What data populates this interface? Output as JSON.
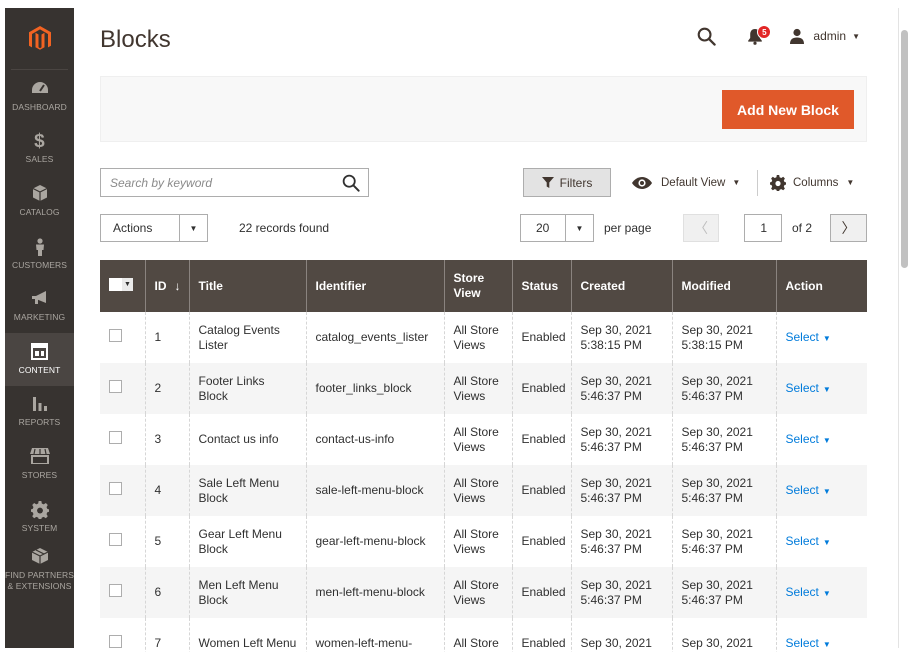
{
  "sidebar": {
    "items": [
      {
        "label": "DASHBOARD",
        "icon": "dashboard-gauge-icon"
      },
      {
        "label": "SALES",
        "icon": "dollar-icon"
      },
      {
        "label": "CATALOG",
        "icon": "cube-icon"
      },
      {
        "label": "CUSTOMERS",
        "icon": "person-icon"
      },
      {
        "label": "MARKETING",
        "icon": "megaphone-icon"
      },
      {
        "label": "CONTENT",
        "icon": "layout-icon",
        "active": true
      },
      {
        "label": "REPORTS",
        "icon": "bar-chart-icon"
      },
      {
        "label": "STORES",
        "icon": "storefront-icon"
      },
      {
        "label": "SYSTEM",
        "icon": "gear-icon"
      },
      {
        "label": "FIND PARTNERS & EXTENSIONS",
        "icon": "boxes-icon"
      }
    ]
  },
  "header": {
    "title": "Blocks",
    "notifications_count": "5",
    "user_name": "admin"
  },
  "toolbar": {
    "add_new_label": "Add New Block"
  },
  "grid_controls": {
    "search_placeholder": "Search by keyword",
    "filters_label": "Filters",
    "view_label": "Default View",
    "columns_label": "Columns",
    "actions_label": "Actions",
    "records_found": "22 records found",
    "per_page_value": "20",
    "per_page_label": "per page",
    "current_page": "1",
    "total_pages_label": "of 2"
  },
  "table": {
    "columns": [
      "ID",
      "Title",
      "Identifier",
      "Store View",
      "Status",
      "Created",
      "Modified",
      "Action"
    ],
    "sort_indicator": "↓",
    "rows": [
      {
        "id": "1",
        "title": "Catalog Events Lister",
        "identifier": "catalog_events_lister",
        "store_view": "All Store Views",
        "status": "Enabled",
        "created": "Sep 30, 2021 5:38:15 PM",
        "modified": "Sep 30, 2021 5:38:15 PM",
        "action": "Select"
      },
      {
        "id": "2",
        "title": "Footer Links Block",
        "identifier": "footer_links_block",
        "store_view": "All Store Views",
        "status": "Enabled",
        "created": "Sep 30, 2021 5:46:37 PM",
        "modified": "Sep 30, 2021 5:46:37 PM",
        "action": "Select"
      },
      {
        "id": "3",
        "title": "Contact us info",
        "identifier": "contact-us-info",
        "store_view": "All Store Views",
        "status": "Enabled",
        "created": "Sep 30, 2021 5:46:37 PM",
        "modified": "Sep 30, 2021 5:46:37 PM",
        "action": "Select"
      },
      {
        "id": "4",
        "title": "Sale Left Menu Block",
        "identifier": "sale-left-menu-block",
        "store_view": "All Store Views",
        "status": "Enabled",
        "created": "Sep 30, 2021 5:46:37 PM",
        "modified": "Sep 30, 2021 5:46:37 PM",
        "action": "Select"
      },
      {
        "id": "5",
        "title": "Gear Left Menu Block",
        "identifier": "gear-left-menu-block",
        "store_view": "All Store Views",
        "status": "Enabled",
        "created": "Sep 30, 2021 5:46:37 PM",
        "modified": "Sep 30, 2021 5:46:37 PM",
        "action": "Select"
      },
      {
        "id": "6",
        "title": "Men Left Menu Block",
        "identifier": "men-left-menu-block",
        "store_view": "All Store Views",
        "status": "Enabled",
        "created": "Sep 30, 2021 5:46:37 PM",
        "modified": "Sep 30, 2021 5:46:37 PM",
        "action": "Select"
      },
      {
        "id": "7",
        "title": "Women Left Menu",
        "identifier": "women-left-menu-",
        "store_view": "All Store",
        "status": "Enabled",
        "created": "Sep 30, 2021",
        "modified": "Sep 30, 2021",
        "action": "Select"
      }
    ]
  },
  "colors": {
    "sidebar_bg": "#373330",
    "header_row_bg": "#514943",
    "accent_orange": "#e0592a",
    "link_blue": "#007bdb",
    "badge_red": "#e22626"
  }
}
